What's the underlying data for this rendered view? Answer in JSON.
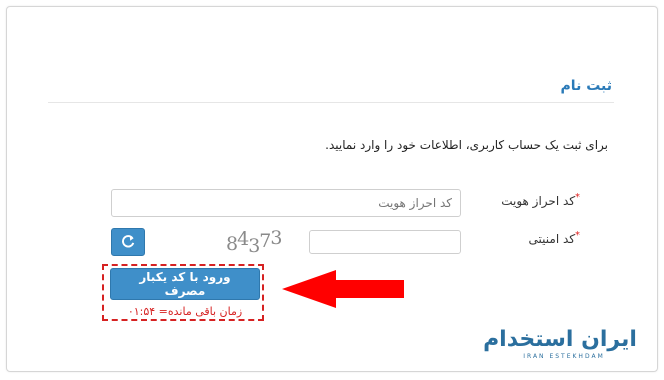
{
  "form": {
    "title": "ثبت نام",
    "intro": "برای ثبت یک حساب کاربری، اطلاعات خود را وارد نمایید.",
    "identity": {
      "label": "کد احراز هویت",
      "required_mark": "*",
      "placeholder": "کد احراز هویت",
      "value": ""
    },
    "security": {
      "label": "کد امنیتی",
      "required_mark": "*",
      "value": "",
      "captcha_text": "84373"
    },
    "otp_button_label": "ورود با کد یکبار مصرف",
    "timer_text": "زمان باقی مانده= ۰۱:۵۴"
  },
  "logo": {
    "text": "ایران استخدام",
    "subtext": "IRAN ESTEKHDAM"
  },
  "colors": {
    "accent": "#3f8fc9",
    "title": "#2a7ab8",
    "highlight": "#d62222"
  },
  "icons": {
    "refresh": "refresh-icon",
    "annotation_arrow": "arrow-left-icon"
  }
}
